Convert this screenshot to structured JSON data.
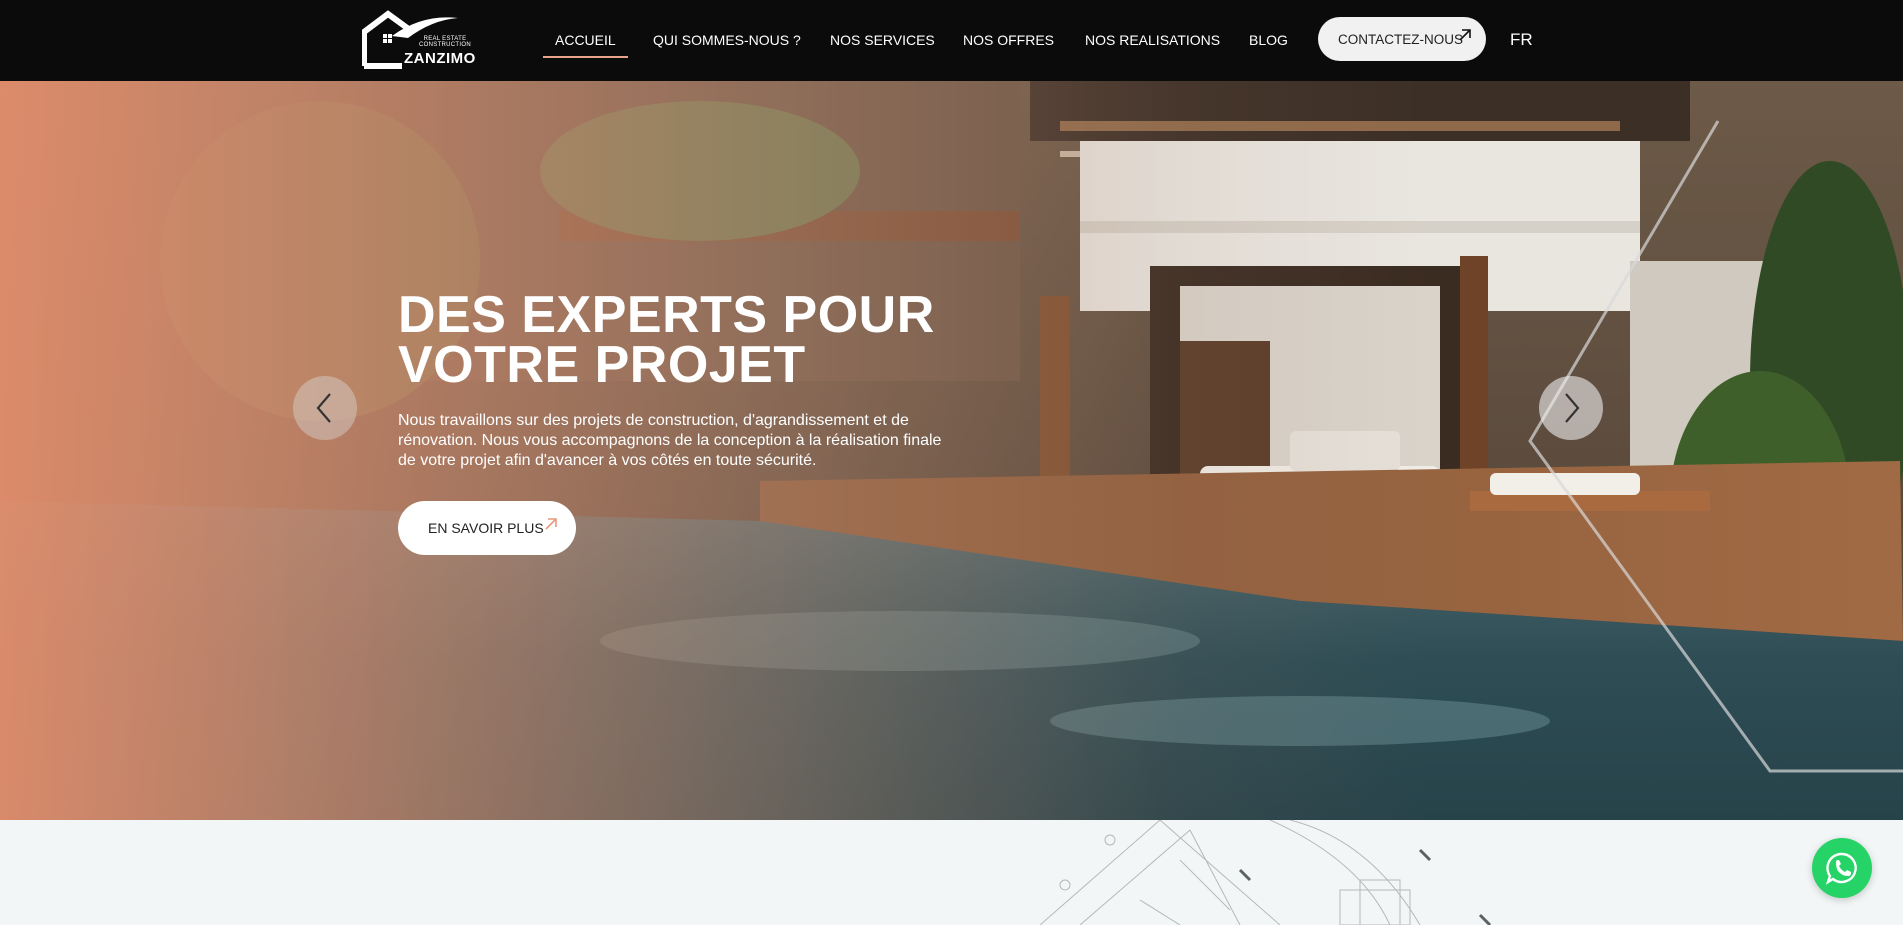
{
  "header": {
    "logo": {
      "tagline": "REAL ESTATE\nCONSTRUCTION",
      "brand": "ZANZIMO",
      "icon": "house-logo-icon"
    },
    "nav": [
      {
        "label": "ACCUEIL",
        "active": true
      },
      {
        "label": "QUI SOMMES-NOUS ?",
        "active": false
      },
      {
        "label": "NOS SERVICES",
        "active": false
      },
      {
        "label": "NOS OFFRES",
        "active": false
      },
      {
        "label": "NOS REALISATIONS",
        "active": false
      },
      {
        "label": "BLOG",
        "active": false
      }
    ],
    "contact_label": "CONTACTEZ-NOUS",
    "contact_icon": "arrow-up-right-icon",
    "language": "FR"
  },
  "hero": {
    "title": "DES EXPERTS POUR VOTRE PROJET",
    "text": "Nous travaillons sur des projets de construction, d'agrandissement et de rénovation. Nous vous accompagnons de la conception à la réalisation finale de votre projet afin d'avancer à vos côtés en toute sécurité.",
    "cta_label": "EN SAVOIR PLUS",
    "cta_icon": "arrow-up-right-icon",
    "prev_icon": "chevron-left-icon",
    "next_icon": "chevron-right-icon"
  },
  "floating": {
    "whatsapp_icon": "whatsapp-icon"
  },
  "colors": {
    "header_bg": "#0b0b0b",
    "accent": "#e7a48a",
    "whatsapp": "#25d366",
    "section_bg": "#f3f6f6"
  }
}
